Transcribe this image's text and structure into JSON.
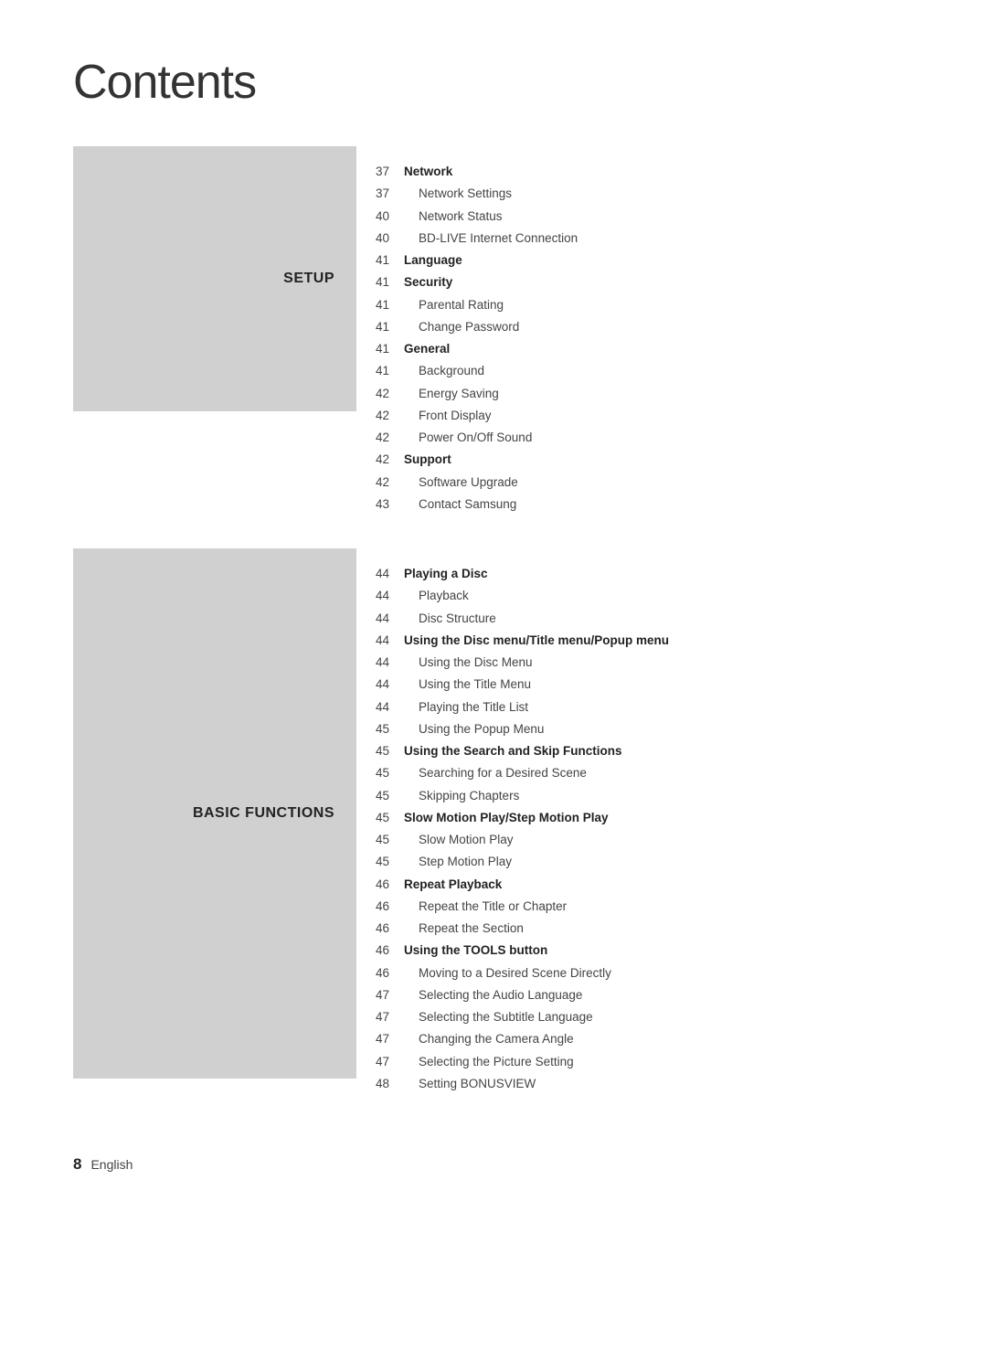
{
  "page": {
    "title": "Contents",
    "footer": {
      "page_number": "8",
      "language": "English"
    }
  },
  "sections": [
    {
      "id": "setup",
      "label": "SETUP",
      "entries": [
        {
          "number": "37",
          "text": "Network",
          "bold": true,
          "sub": false
        },
        {
          "number": "37",
          "text": "Network Settings",
          "bold": false,
          "sub": true
        },
        {
          "number": "40",
          "text": "Network Status",
          "bold": false,
          "sub": true
        },
        {
          "number": "40",
          "text": "BD-LIVE Internet Connection",
          "bold": false,
          "sub": true
        },
        {
          "number": "41",
          "text": "Language",
          "bold": true,
          "sub": false
        },
        {
          "number": "41",
          "text": "Security",
          "bold": true,
          "sub": false
        },
        {
          "number": "41",
          "text": "Parental Rating",
          "bold": false,
          "sub": true
        },
        {
          "number": "41",
          "text": "Change Password",
          "bold": false,
          "sub": true
        },
        {
          "number": "41",
          "text": "General",
          "bold": true,
          "sub": false
        },
        {
          "number": "41",
          "text": "Background",
          "bold": false,
          "sub": true
        },
        {
          "number": "42",
          "text": "Energy Saving",
          "bold": false,
          "sub": true
        },
        {
          "number": "42",
          "text": "Front Display",
          "bold": false,
          "sub": true
        },
        {
          "number": "42",
          "text": "Power On/Off Sound",
          "bold": false,
          "sub": true
        },
        {
          "number": "42",
          "text": "Support",
          "bold": true,
          "sub": false
        },
        {
          "number": "42",
          "text": "Software Upgrade",
          "bold": false,
          "sub": true
        },
        {
          "number": "43",
          "text": "Contact Samsung",
          "bold": false,
          "sub": true
        }
      ]
    },
    {
      "id": "basic-functions",
      "label": "BASIC FUNCTIONS",
      "entries": [
        {
          "number": "44",
          "text": "Playing a Disc",
          "bold": true,
          "sub": false
        },
        {
          "number": "44",
          "text": "Playback",
          "bold": false,
          "sub": true
        },
        {
          "number": "44",
          "text": "Disc Structure",
          "bold": false,
          "sub": true
        },
        {
          "number": "44",
          "text": "Using the Disc menu/Title menu/Popup menu",
          "bold": true,
          "sub": false
        },
        {
          "number": "44",
          "text": "Using the Disc Menu",
          "bold": false,
          "sub": true
        },
        {
          "number": "44",
          "text": "Using the Title Menu",
          "bold": false,
          "sub": true
        },
        {
          "number": "44",
          "text": "Playing the Title List",
          "bold": false,
          "sub": true
        },
        {
          "number": "45",
          "text": "Using the Popup Menu",
          "bold": false,
          "sub": true
        },
        {
          "number": "45",
          "text": "Using the Search and Skip Functions",
          "bold": true,
          "sub": false
        },
        {
          "number": "45",
          "text": "Searching for a Desired Scene",
          "bold": false,
          "sub": true
        },
        {
          "number": "45",
          "text": "Skipping Chapters",
          "bold": false,
          "sub": true
        },
        {
          "number": "45",
          "text": "Slow Motion Play/Step Motion Play",
          "bold": true,
          "sub": false
        },
        {
          "number": "45",
          "text": "Slow Motion Play",
          "bold": false,
          "sub": true
        },
        {
          "number": "45",
          "text": "Step Motion Play",
          "bold": false,
          "sub": true
        },
        {
          "number": "46",
          "text": "Repeat Playback",
          "bold": true,
          "sub": false
        },
        {
          "number": "46",
          "text": "Repeat the Title or Chapter",
          "bold": false,
          "sub": true
        },
        {
          "number": "46",
          "text": "Repeat the Section",
          "bold": false,
          "sub": true
        },
        {
          "number": "46",
          "text": "Using the TOOLS button",
          "bold": true,
          "sub": false
        },
        {
          "number": "46",
          "text": "Moving to a Desired Scene Directly",
          "bold": false,
          "sub": true
        },
        {
          "number": "47",
          "text": "Selecting the Audio Language",
          "bold": false,
          "sub": true
        },
        {
          "number": "47",
          "text": "Selecting the Subtitle Language",
          "bold": false,
          "sub": true
        },
        {
          "number": "47",
          "text": "Changing the Camera Angle",
          "bold": false,
          "sub": true
        },
        {
          "number": "47",
          "text": "Selecting the Picture Setting",
          "bold": false,
          "sub": true
        },
        {
          "number": "48",
          "text": "Setting BONUSVIEW",
          "bold": false,
          "sub": true
        }
      ]
    }
  ]
}
